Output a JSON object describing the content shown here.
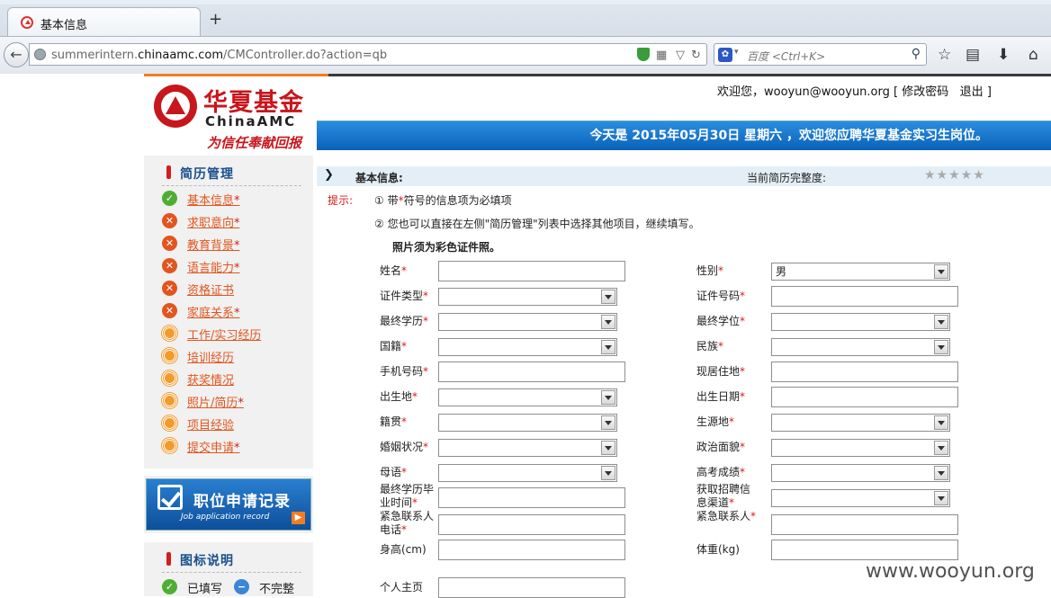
{
  "browser": {
    "tab_title": "基本信息",
    "new_tab": "+",
    "url_prefix": "summerintern.",
    "url_domain": "chinaamc.com",
    "url_path": "/CMController.do?action=qb",
    "search_placeholder": "百度 <Ctrl+K>"
  },
  "header": {
    "logo_cn": "华夏基金",
    "logo_en": "ChinaAMC",
    "slogan": "为信任奉献回报",
    "welcome": "欢迎您，wooyun@wooyun.org [",
    "change_password": "修改密码",
    "logout": "退出",
    "close_bracket": "]",
    "banner": "今天是 2015年05月30日 星期六 ，欢迎您应聘华夏基金实习生岗位。"
  },
  "sidebar": {
    "resume_title": "简历管理",
    "items": [
      {
        "label": "基本信息",
        "required": "*",
        "status": "ok",
        "glyph": "✓"
      },
      {
        "label": "求职意向",
        "required": "*",
        "status": "no",
        "glyph": "✕"
      },
      {
        "label": "教育背景",
        "required": "*",
        "status": "no",
        "glyph": "✕"
      },
      {
        "label": "语言能力",
        "required": "*",
        "status": "no",
        "glyph": "✕"
      },
      {
        "label": "资格证书",
        "required": "",
        "status": "no",
        "glyph": "✕"
      },
      {
        "label": "家庭关系",
        "required": "*",
        "status": "no",
        "glyph": "✕"
      },
      {
        "label": "工作/实习经历",
        "required": "",
        "status": "pend",
        "glyph": ""
      },
      {
        "label": "培训经历",
        "required": "",
        "status": "pend",
        "glyph": ""
      },
      {
        "label": "获奖情况",
        "required": "",
        "status": "pend",
        "glyph": ""
      },
      {
        "label": "照片/简历",
        "required": "*",
        "status": "pend",
        "glyph": ""
      },
      {
        "label": "项目经验",
        "required": "",
        "status": "pend",
        "glyph": ""
      },
      {
        "label": "提交申请",
        "required": "*",
        "status": "pend",
        "glyph": ""
      }
    ],
    "job_record_title": "职位申请记录",
    "job_record_sub": "Job application record",
    "legend_title": "图标说明",
    "legend_filled": "已填写",
    "legend_incomplete": "不完整"
  },
  "main": {
    "section_label": "基本信息:",
    "completeness_label": "当前简历完整度:",
    "stars": "★★★★★",
    "tip_label": "提示:",
    "tip1_pre": "① 带",
    "tip1_star": "*",
    "tip1_post": "符号的信息项为必填项",
    "tip2": "② 您也可以直接在左侧\"简历管理\"列表中选择其他项目，继续填写。",
    "photo_note": "照片须为彩色证件照。",
    "fields": [
      {
        "label": "姓名",
        "req": "*",
        "type": "input",
        "value": ""
      },
      {
        "label": "性别",
        "req": "*",
        "type": "select",
        "value": "男"
      },
      {
        "label": "证件类型",
        "req": "*",
        "type": "select",
        "value": ""
      },
      {
        "label": "证件号码",
        "req": "*",
        "type": "input",
        "value": ""
      },
      {
        "label": "最终学历",
        "req": "*",
        "type": "select",
        "value": ""
      },
      {
        "label": "最终学位",
        "req": "*",
        "type": "select",
        "value": ""
      },
      {
        "label": "国籍",
        "req": "*",
        "type": "select",
        "value": ""
      },
      {
        "label": "民族",
        "req": "*",
        "type": "select",
        "value": ""
      },
      {
        "label": "手机号码",
        "req": "*",
        "type": "input",
        "value": ""
      },
      {
        "label": "现居住地",
        "req": "*",
        "type": "input",
        "value": ""
      },
      {
        "label": "出生地",
        "req": "*",
        "type": "select",
        "value": ""
      },
      {
        "label": "出生日期",
        "req": "*",
        "type": "input",
        "value": ""
      },
      {
        "label": "籍贯",
        "req": "*",
        "type": "select",
        "value": ""
      },
      {
        "label": "生源地",
        "req": "*",
        "type": "select",
        "value": ""
      },
      {
        "label": "婚姻状况",
        "req": "*",
        "type": "select",
        "value": ""
      },
      {
        "label": "政治面貌",
        "req": "*",
        "type": "select",
        "value": ""
      },
      {
        "label": "母语",
        "req": "*",
        "type": "select",
        "value": ""
      },
      {
        "label": "高考成绩",
        "req": "*",
        "type": "select",
        "value": ""
      },
      {
        "label": "最终学历毕业时间",
        "req": "*",
        "type": "input",
        "value": ""
      },
      {
        "label": "获取招聘信息渠道",
        "req": "*",
        "type": "select",
        "value": ""
      },
      {
        "label": "紧急联系人电话",
        "req": "*",
        "type": "input",
        "value": ""
      },
      {
        "label": "紧急联系人",
        "req": "*",
        "type": "input",
        "value": ""
      },
      {
        "label": "身高(cm)",
        "req": "",
        "type": "input",
        "value": ""
      },
      {
        "label": "体重(kg)",
        "req": "",
        "type": "input",
        "value": ""
      },
      {
        "label": "个人主页",
        "req": "",
        "type": "input",
        "value": ""
      }
    ]
  },
  "watermark": "www.wooyun.org"
}
